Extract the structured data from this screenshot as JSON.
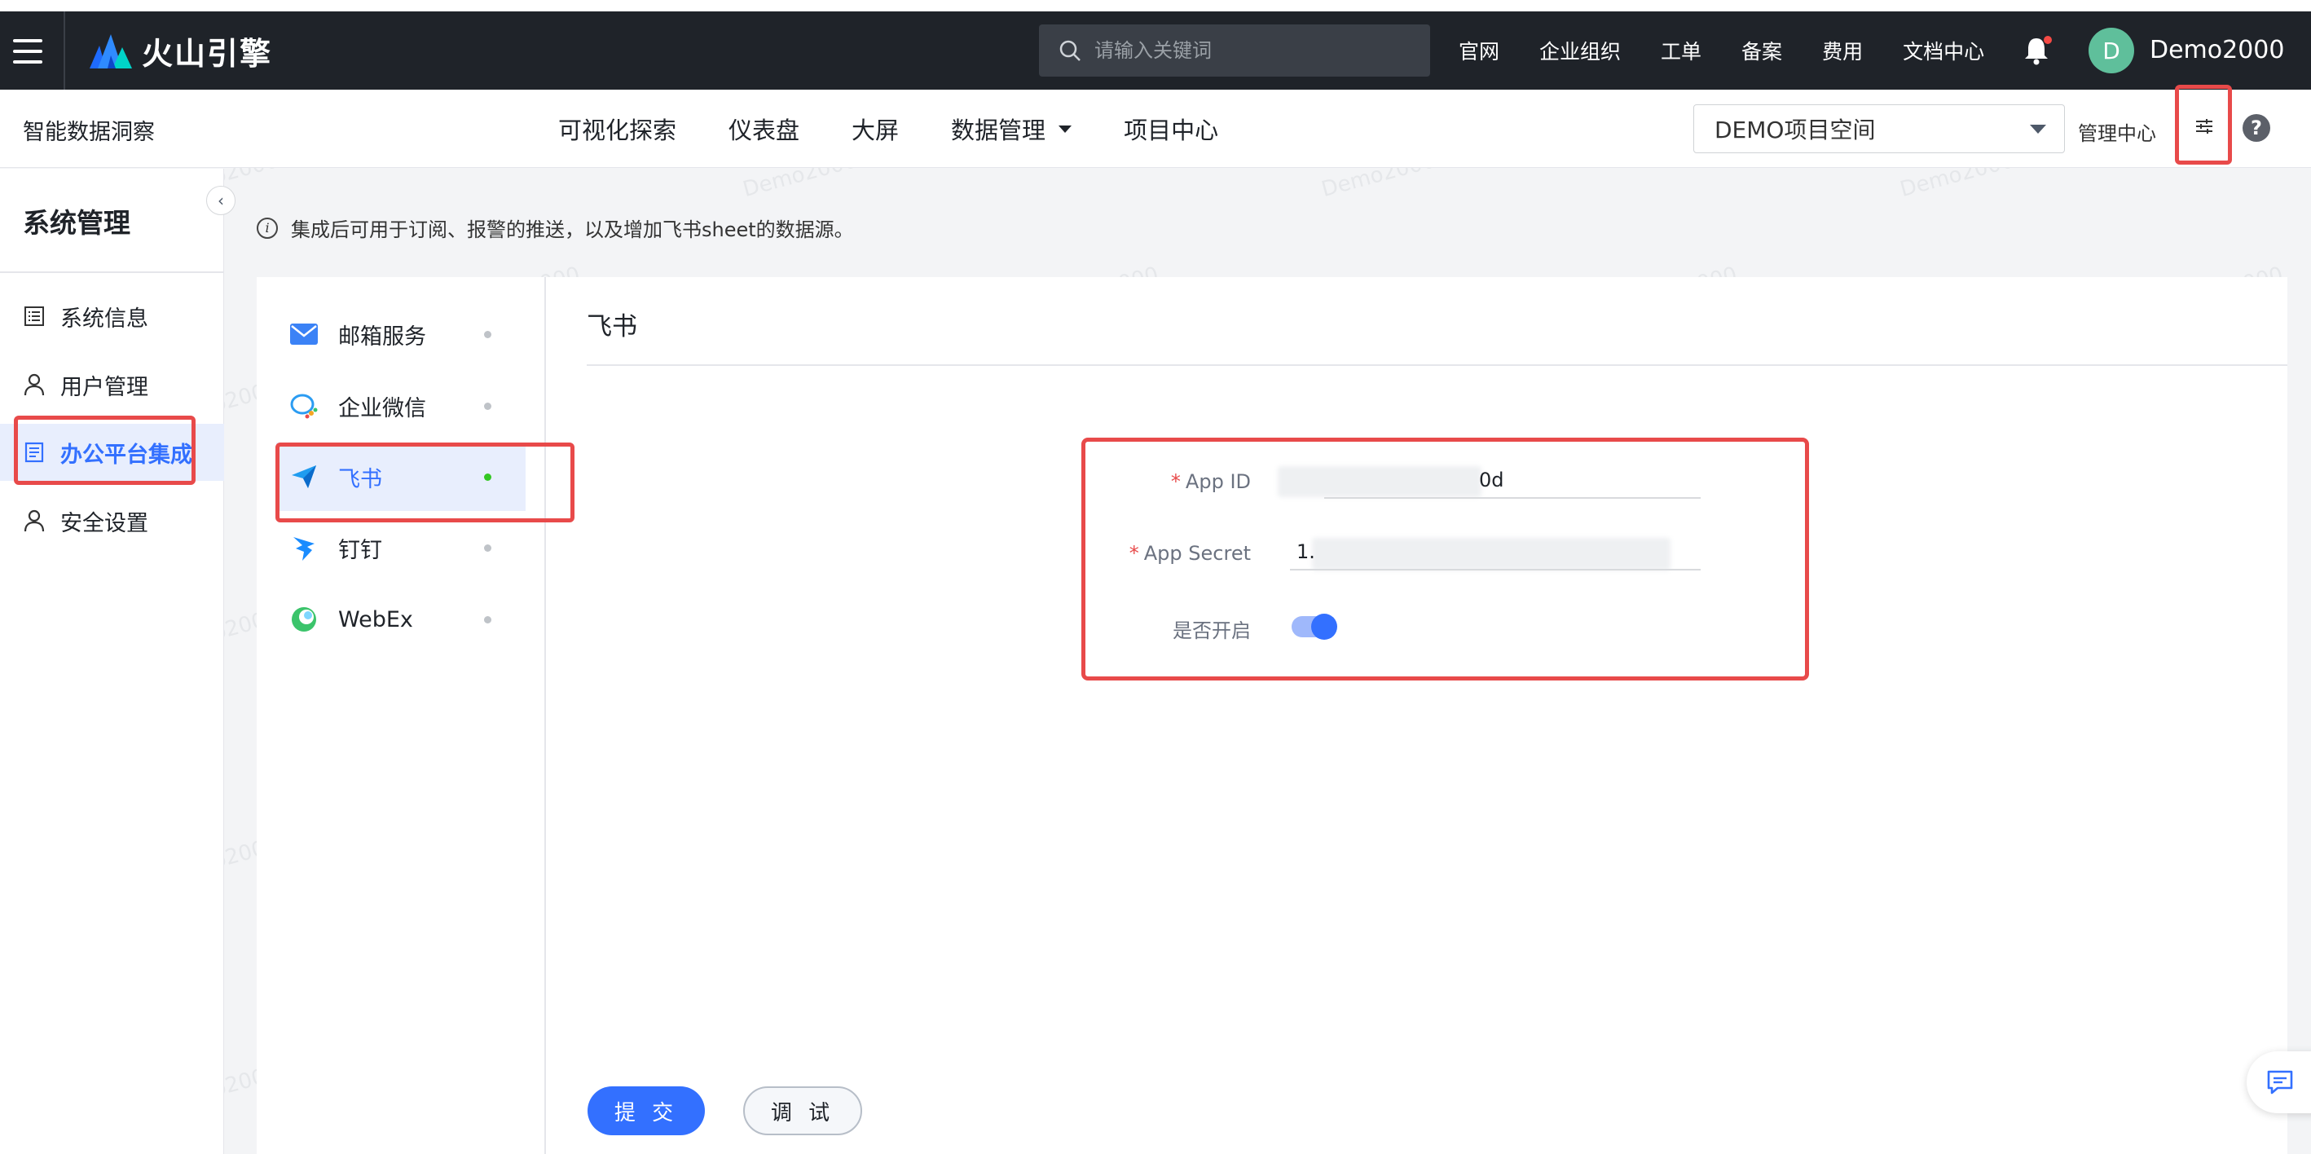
{
  "header": {
    "brand": "火山引擎",
    "search_placeholder": "请输入关键词",
    "nav": [
      "官网",
      "企业组织",
      "工单",
      "备案",
      "费用",
      "文档中心"
    ],
    "avatar_initial": "D",
    "username": "Demo2000"
  },
  "subheader": {
    "app_name": "智能数据洞察",
    "nav": [
      {
        "label": "可视化探索"
      },
      {
        "label": "仪表盘"
      },
      {
        "label": "大屏"
      },
      {
        "label": "数据管理",
        "dropdown": true
      },
      {
        "label": "项目中心"
      }
    ],
    "project_select": "DEMO项目空间",
    "admin_link": "管理中心",
    "help": "?"
  },
  "sidebar": {
    "title": "系统管理",
    "items": [
      {
        "label": "系统信息",
        "icon": "list-icon"
      },
      {
        "label": "用户管理",
        "icon": "user-icon"
      },
      {
        "label": "办公平台集成",
        "icon": "doc-icon",
        "active": true
      },
      {
        "label": "安全设置",
        "icon": "user-icon"
      }
    ]
  },
  "info": {
    "text": "集成后可用于订阅、报警的推送，以及增加飞书sheet的数据源。"
  },
  "channels": [
    {
      "label": "邮箱服务",
      "icon": "mail-icon"
    },
    {
      "label": "企业微信",
      "icon": "wecom-icon"
    },
    {
      "label": "飞书",
      "icon": "feishu-icon",
      "active": true
    },
    {
      "label": "钉钉",
      "icon": "dingtalk-icon"
    },
    {
      "label": "WebEx",
      "icon": "webex-icon"
    }
  ],
  "form": {
    "title": "飞书",
    "app_id_label": "App ID",
    "app_id_value": "0d",
    "app_secret_label": "App Secret",
    "app_secret_value": "1.",
    "enable_label": "是否开启",
    "enabled": true
  },
  "actions": {
    "submit": "提 交",
    "debug": "调 试"
  },
  "watermark": "Demo2000",
  "colors": {
    "primary": "#3370ff",
    "highlight": "#e84a4a",
    "topbar": "#1f2329"
  }
}
